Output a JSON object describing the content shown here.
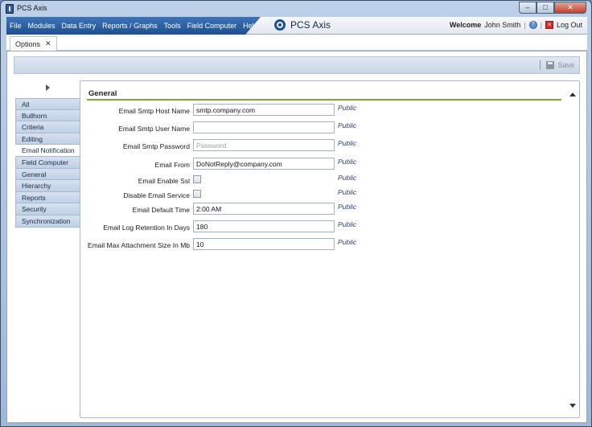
{
  "window": {
    "title": "PCS Axis",
    "min": "–",
    "max": "□",
    "close": "✕"
  },
  "menu": {
    "items": [
      "File",
      "Modules",
      "Data Entry",
      "Reports / Graphs",
      "Tools",
      "Field Computer",
      "Help"
    ],
    "brand": "PCS Axis",
    "welcome_label": "Welcome",
    "user": "John Smith",
    "sep1": "|",
    "sep2": "|",
    "logout": "Log Out"
  },
  "tab": {
    "label": "Options",
    "close": "✕"
  },
  "toolbar": {
    "save": "Save"
  },
  "sidebar": {
    "items": [
      "All",
      "Bullhorn",
      "Criteria",
      "Editing",
      "Email Notification",
      "Field Computer",
      "General",
      "Hierarchy",
      "Reports",
      "Security",
      "Synchronization"
    ],
    "active": "Email Notification"
  },
  "section": {
    "title": "General"
  },
  "fields": [
    {
      "label": "Email Smtp Host Name",
      "value": "smtp.company.com",
      "placeholder": "",
      "scope": "Public"
    },
    {
      "label": "Email Smtp User Name",
      "value": "",
      "placeholder": "",
      "scope": "Public"
    },
    {
      "label": "Email Smtp Password",
      "value": "",
      "placeholder": "Password",
      "scope": "Public"
    },
    {
      "label": "Email From",
      "value": "DoNotReply@company.com",
      "placeholder": "",
      "scope": "Public"
    },
    {
      "label": "Email Enable Ssl",
      "value": "",
      "placeholder": "",
      "scope": "Public"
    },
    {
      "label": "Disable Email Service",
      "value": "",
      "placeholder": "",
      "scope": "Public"
    },
    {
      "label": "Email Default Time",
      "value": "2:00 AM",
      "placeholder": "",
      "scope": "Public"
    },
    {
      "label": "Email Log Retention In Days",
      "value": "180",
      "placeholder": "",
      "scope": "Public"
    },
    {
      "label": "Email Max Attachment Size In Mb",
      "value": "10",
      "placeholder": "",
      "scope": "Public"
    }
  ]
}
